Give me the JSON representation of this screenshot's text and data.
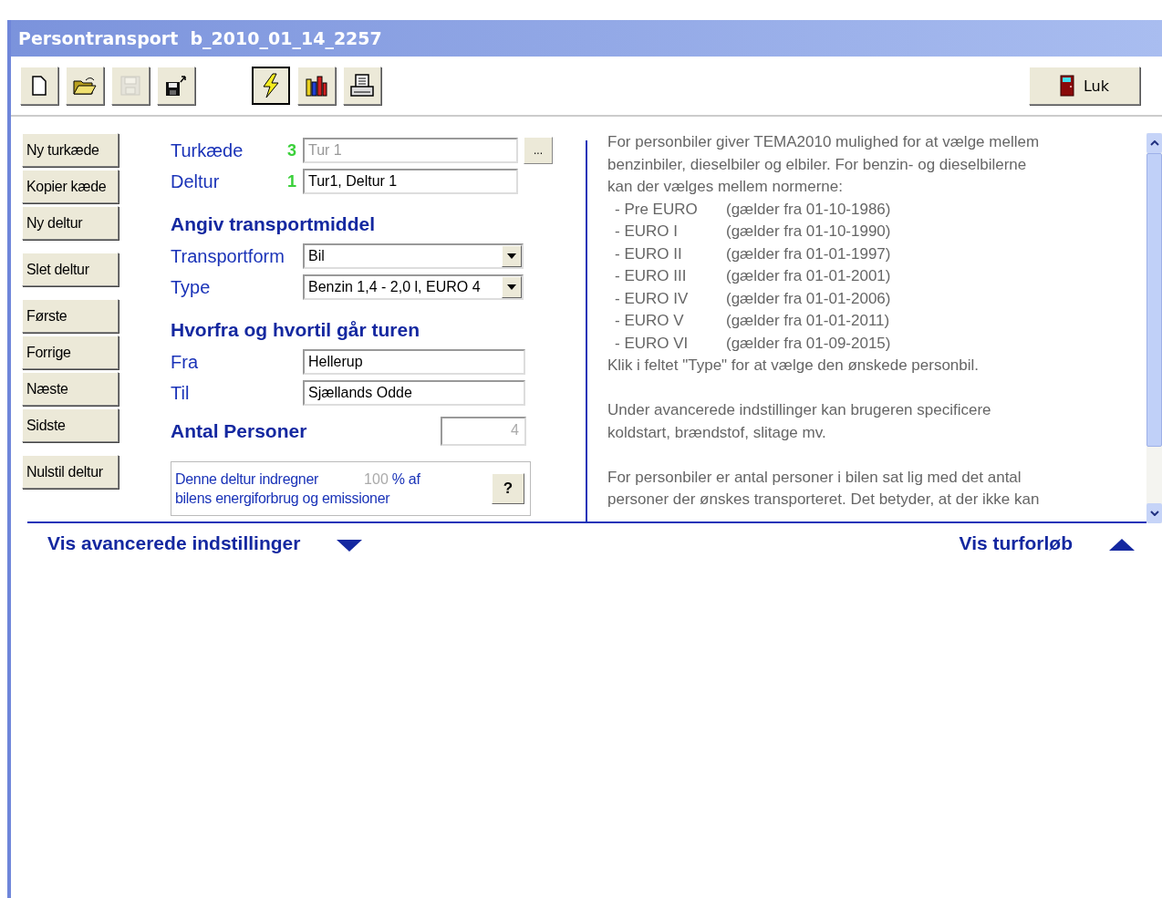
{
  "window": {
    "title": "Persontransport  b_2010_01_14_2257"
  },
  "toolbar": [
    {
      "kind": "new",
      "selected": false,
      "disabled": false
    },
    {
      "kind": "open",
      "selected": false,
      "disabled": false
    },
    {
      "kind": "save",
      "selected": false,
      "disabled": true
    },
    {
      "kind": "export",
      "selected": false,
      "disabled": false
    },
    {
      "kind": "calculate",
      "selected": true,
      "disabled": false
    },
    {
      "kind": "chart",
      "selected": false,
      "disabled": false
    },
    {
      "kind": "print",
      "selected": false,
      "disabled": false
    }
  ],
  "close_button": {
    "label": "Luk"
  },
  "side_buttons": [
    [
      "Ny turkæde",
      "Kopier kæde",
      "Ny deltur"
    ],
    [
      "Slet deltur"
    ],
    [
      "Første",
      "Forrige",
      "Næste",
      "Sidste"
    ],
    [
      "Nulstil deltur"
    ]
  ],
  "trip": {
    "chain": {
      "label": "Turkæde",
      "count": "3",
      "value": "Tur 1",
      "disabled": true,
      "browse": "..."
    },
    "leg": {
      "label": "Deltur",
      "count": "1",
      "value": "Tur1, Deltur 1",
      "disabled": false
    }
  },
  "transport": {
    "heading": "Angiv transportmiddel",
    "fields": [
      {
        "label": "Transportform",
        "value": "Bil"
      },
      {
        "label": "Type",
        "value": "Benzin 1,4 - 2,0 l, EURO 4"
      }
    ]
  },
  "route": {
    "heading": "Hvorfra og hvortil går turen",
    "fields": [
      {
        "label": "Fra",
        "value": "Hellerup"
      },
      {
        "label": "Til",
        "value": "Sjællands Odde"
      }
    ]
  },
  "persons": {
    "heading": "Antal Personer",
    "value": "4",
    "disabled": true
  },
  "share": {
    "text_before": "Denne deltur indregner",
    "percent": "100",
    "unit": "% af",
    "text_after": "bilens energiforbrug og emissioner",
    "help": "?"
  },
  "help": {
    "intro": [
      "For personbiler giver TEMA2010 mulighed for at vælge mellem",
      "benzinbiler, dieselbiler og elbiler. For benzin- og dieselbilerne",
      "kan der vælges mellem normerne:"
    ],
    "norms": [
      {
        "name": "- Pre EURO",
        "valid": "(gælder fra 01-10-1986)"
      },
      {
        "name": "- EURO I",
        "valid": "(gælder fra 01-10-1990)"
      },
      {
        "name": "- EURO II",
        "valid": "(gælder fra 01-01-1997)"
      },
      {
        "name": "- EURO III",
        "valid": "(gælder fra 01-01-2001)"
      },
      {
        "name": "- EURO IV",
        "valid": "(gælder fra 01-01-2006)"
      },
      {
        "name": "- EURO V",
        "valid": "(gælder fra 01-01-2011)"
      },
      {
        "name": "- EURO VI",
        "valid": "(gælder fra 01-09-2015)"
      }
    ],
    "hint": "Klik i feltet \"Type\" for at vælge den ønskede personbil.",
    "paragraphs": [
      [
        "Under avancerede indstillinger kan brugeren specificere",
        "koldstart, brændstof, slitage mv."
      ],
      [
        "For personbiler er antal personer i bilen sat lig med det antal",
        "personer der ønskes transporteret. Det betyder, at der ikke kan"
      ]
    ]
  },
  "bottom_links": [
    {
      "label": "Vis avancerede indstillinger",
      "expanded": false
    },
    {
      "label": "Vis turforløb",
      "expanded": true
    }
  ]
}
